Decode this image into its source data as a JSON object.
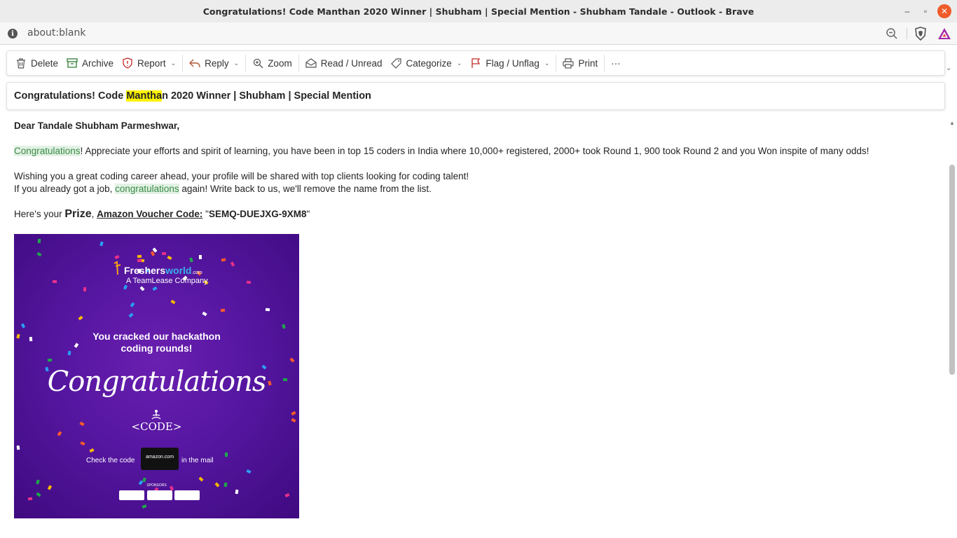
{
  "window": {
    "title": "Congratulations! Code Manthan 2020 Winner | Shubham | Special Mention - Shubham Tandale - Outlook - Brave",
    "minimize": "–",
    "maximize": "▫",
    "close": "✕"
  },
  "urlbar": {
    "url": "about:blank",
    "info": "i"
  },
  "toolbar": {
    "delete": "Delete",
    "archive": "Archive",
    "report": "Report",
    "reply": "Reply",
    "zoom": "Zoom",
    "read_unread": "Read / Unread",
    "categorize": "Categorize",
    "flag": "Flag / Unflag",
    "print": "Print",
    "more": "···"
  },
  "subject": {
    "before": "Congratulations! Code ",
    "highlight": "Mantha",
    "after": "n 2020 Winner | Shubham | Special Mention"
  },
  "body": {
    "greeting": "Dear Tandale Shubham Parmeshwar,",
    "p1_hl": "Congratulations",
    "p1_rest": "! Appreciate your efforts and spirit of learning, you have been in top 15 coders in India where 10,000+ registered, 2000+ took Round 1, 900 took Round 2 and you Won inspite of many odds!",
    "p2": "Wishing you a great coding career ahead, your profile will be shared with top clients looking for coding talent!",
    "p3_before": "If you already got a job, ",
    "p3_hl": "congratulations",
    "p3_after": " again! Write back to us, we'll remove the name from the list.",
    "p4_intro": "Here's your ",
    "p4_prize": "Prize",
    "p4_comma": ", ",
    "p4_voucher_label": "Amazon Voucher Code:",
    "p4_open": " \"",
    "p4_code": "SEMQ-DUEJXG-9XM8",
    "p4_close": "\""
  },
  "banner": {
    "brand1": "Freshers",
    "brand2": "world",
    "brand3": ".com",
    "tagline": "A TeamLease Company",
    "line1": "You cracked our hackathon",
    "line2": "coding rounds!",
    "congrats": "Congratulations",
    "code_logo": "<CODE>",
    "check": "Check the code",
    "amazon": "amazon.com",
    "in_mail": "in the mail",
    "sponsors": "SPONSORS"
  },
  "colors": {
    "accent_highlight": "#fff200",
    "green_highlight_bg": "#e2f2e4",
    "green_highlight_text": "#3b8a47",
    "banner_purple": "#5516a0",
    "close_button": "#ef5b2a"
  }
}
